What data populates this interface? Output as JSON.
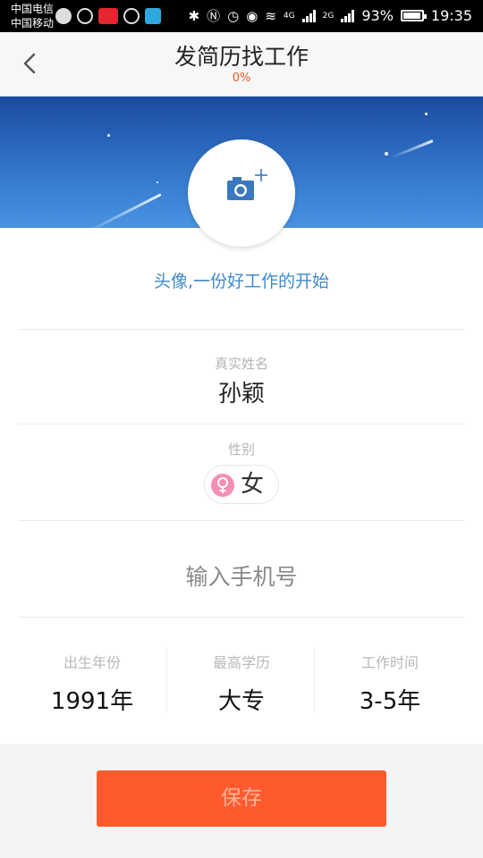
{
  "status_bar": {
    "carrier_1": "中国电信",
    "carrier_2": "中国移动",
    "net_1": "4G",
    "net_2": "2G",
    "battery": "93%",
    "battery_level": 0.93,
    "time": "19:35",
    "icons": [
      "nav-icon",
      "headset-icon",
      "app-icon",
      "sync-icon",
      "store-icon",
      "bluetooth-icon",
      "nfc-icon",
      "alarm-icon",
      "eye-icon",
      "wifi-icon",
      "signal-icon",
      "battery-icon"
    ]
  },
  "header": {
    "title": "发简历找工作",
    "progress": "0%",
    "back_icon": "chevron-left-icon"
  },
  "avatar": {
    "icon": "camera-add-icon",
    "caption": "头像,一份好工作的开始"
  },
  "name_field": {
    "label": "真实姓名",
    "value": "孙颖"
  },
  "gender_field": {
    "label": "性别",
    "value": "女",
    "icon": "female-icon"
  },
  "phone_field": {
    "placeholder": "输入手机号"
  },
  "details": [
    {
      "label": "出生年份",
      "value": "1991年"
    },
    {
      "label": "最高学历",
      "value": "大专"
    },
    {
      "label": "工作时间",
      "value": "3-5年"
    }
  ],
  "save_button": {
    "label": "保存"
  },
  "colors": {
    "accent": "#ff5a2d",
    "link_blue": "#3f8acb",
    "progress_red": "#f25a2a",
    "female_pink": "#f58fb0"
  }
}
